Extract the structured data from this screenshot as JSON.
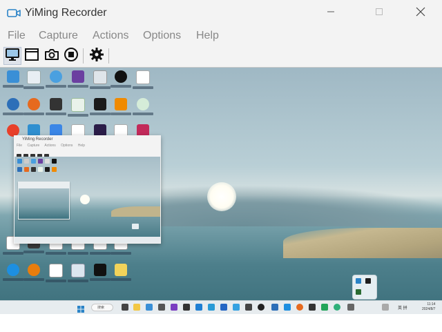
{
  "window": {
    "title": "YiMing Recorder",
    "icon": "camera-icon",
    "controls": {
      "minimize": "—",
      "maximize": "□",
      "close": "✕"
    }
  },
  "menu": {
    "items": [
      {
        "label": "File"
      },
      {
        "label": "Capture"
      },
      {
        "label": "Actions"
      },
      {
        "label": "Options"
      },
      {
        "label": "Help"
      }
    ]
  },
  "toolbar": {
    "buttons": [
      {
        "name": "full-screen-capture",
        "icon": "monitor-icon",
        "active": true
      },
      {
        "name": "window-capture",
        "icon": "window-icon",
        "active": false
      },
      {
        "name": "screenshot",
        "icon": "camera-icon",
        "active": false
      },
      {
        "name": "stop-record",
        "icon": "stop-icon",
        "active": false
      },
      {
        "name": "settings",
        "icon": "gear-icon",
        "active": false
      }
    ]
  },
  "nested_preview": {
    "title": "YiMing Recorder",
    "menu": [
      "File",
      "Capture",
      "Actions",
      "Options",
      "Help"
    ]
  },
  "taskbar": {
    "search_placeholder": "搜索",
    "tray_text": "英 拼",
    "clock_time": "11:14",
    "clock_date": "2024/8/7"
  },
  "colors": {
    "chrome": "#f3f3f3",
    "accent": "#2a83c7",
    "sky": "#b9cfd6",
    "water": "#4d7f8b"
  }
}
